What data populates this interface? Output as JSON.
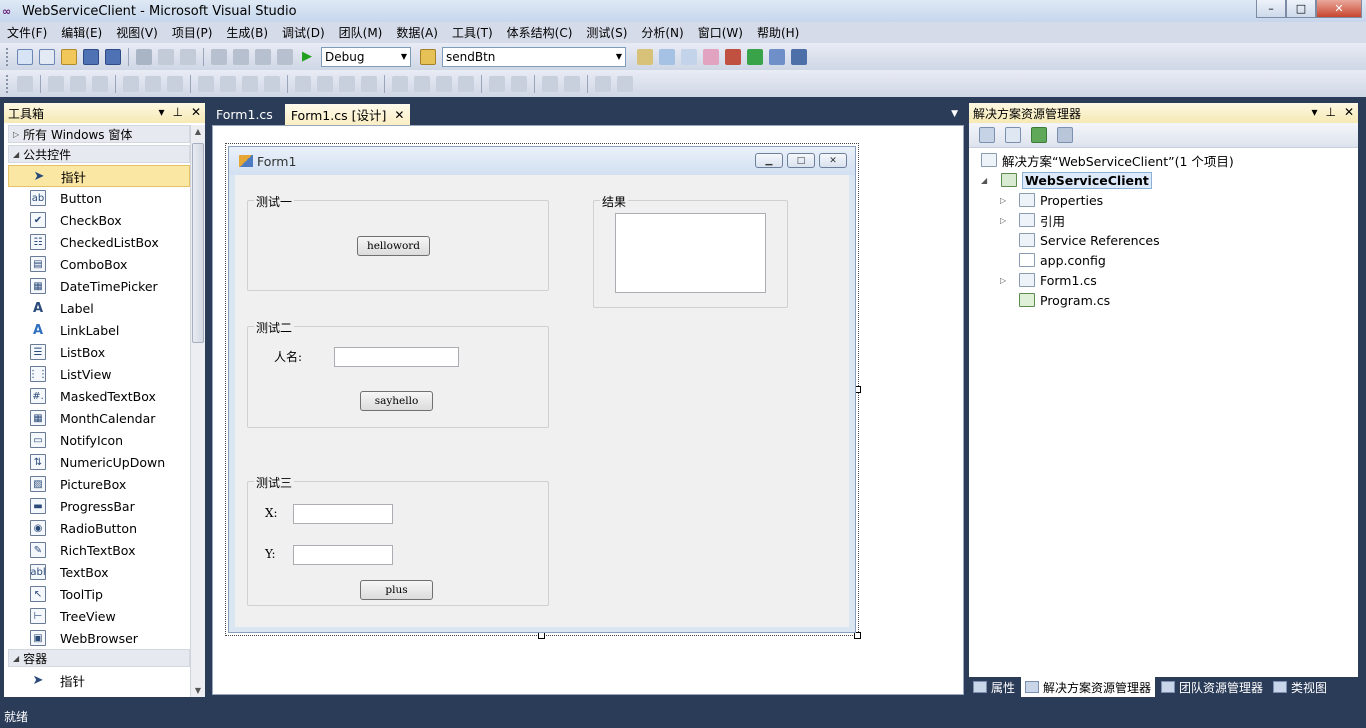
{
  "window": {
    "title": "WebServiceClient - Microsoft Visual Studio",
    "min": "–",
    "max": "□",
    "close": "✕"
  },
  "menu": [
    "文件(F)",
    "编辑(E)",
    "视图(V)",
    "项目(P)",
    "生成(B)",
    "调试(D)",
    "团队(M)",
    "数据(A)",
    "工具(T)",
    "体系结构(C)",
    "测试(S)",
    "分析(N)",
    "窗口(W)",
    "帮助(H)"
  ],
  "toolbar": {
    "config": "Debug",
    "find": "sendBtn"
  },
  "toolbox": {
    "title": "工具箱",
    "groups": {
      "all": "所有 Windows 窗体",
      "common": "公共控件",
      "containers": "容器"
    },
    "items": [
      "指针",
      "Button",
      "CheckBox",
      "CheckedListBox",
      "ComboBox",
      "DateTimePicker",
      "Label",
      "LinkLabel",
      "ListBox",
      "ListView",
      "MaskedTextBox",
      "MonthCalendar",
      "NotifyIcon",
      "NumericUpDown",
      "PictureBox",
      "ProgressBar",
      "RadioButton",
      "RichTextBox",
      "TextBox",
      "ToolTip",
      "TreeView",
      "WebBrowser"
    ],
    "container_items": [
      "指针"
    ],
    "icons": [
      "pointer-icon",
      "button-icon",
      "checkbox-icon",
      "checkedlistbox-icon",
      "combobox-icon",
      "datetimepicker-icon",
      "label-icon",
      "linklabel-icon",
      "listbox-icon",
      "listview-icon",
      "maskedtextbox-icon",
      "monthcalendar-icon",
      "notifyicon-icon",
      "numericupdown-icon",
      "picturebox-icon",
      "progressbar-icon",
      "radiobutton-icon",
      "richtextbox-icon",
      "textbox-icon",
      "tooltip-icon",
      "treeview-icon",
      "webbrowser-icon"
    ],
    "glyphs": [
      "➤",
      "ab",
      "✔",
      "☷",
      "▤",
      "▦",
      "A",
      "A",
      "☰",
      "⋮⋮",
      "#.",
      "▦",
      "▭",
      "⇅",
      "▨",
      "▬",
      "◉",
      "✎",
      "abl",
      "↖",
      "⊢",
      "▣"
    ]
  },
  "doctabs": {
    "tab1": "Form1.cs",
    "tab2": "Form1.cs [设计]"
  },
  "form": {
    "title": "Form1",
    "group1": {
      "legend": "测试一",
      "button": "helloword"
    },
    "group2": {
      "legend": "测试二",
      "label": "人名:",
      "button": "sayhello"
    },
    "group3": {
      "legend": "测试三",
      "label_x": "X:",
      "label_y": "Y:",
      "button": "plus"
    },
    "result": {
      "legend": "结果"
    }
  },
  "solution": {
    "title": "解决方案资源管理器",
    "solution_node": "解决方案“WebServiceClient”(1 个项目)",
    "project": "WebServiceClient",
    "nodes": [
      "Properties",
      "引用",
      "Service References",
      "app.config",
      "Form1.cs",
      "Program.cs"
    ]
  },
  "bottom_tabs": [
    "属性",
    "解决方案资源管理器",
    "团队资源管理器",
    "类视图"
  ],
  "status": "就绪"
}
